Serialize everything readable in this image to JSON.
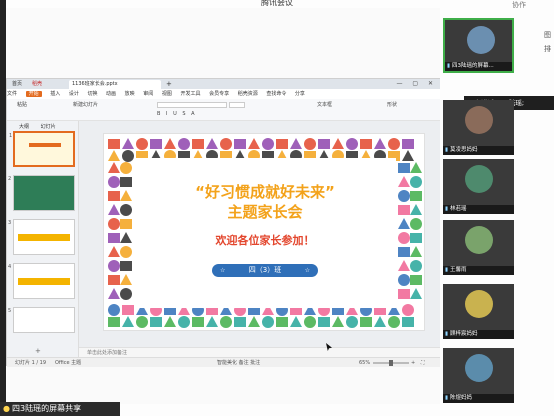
{
  "meeting": {
    "title": "腾讯会议",
    "window_right": "协作"
  },
  "wps": {
    "tabs": [
      "首页",
      "稻壳",
      "1136班家长会.pptx",
      "+"
    ],
    "menu": [
      "文件",
      "开始",
      "插入",
      "设计",
      "切换",
      "动画",
      "放映",
      "审阅",
      "视图",
      "开发工具",
      "会员专享",
      "稻壳资源",
      "查找命令",
      "分享"
    ],
    "ribbon": {
      "paste": "粘贴",
      "new_slide": "新建幻灯片",
      "textbox": "文本框",
      "shape": "形状"
    },
    "sidebar_tabs": [
      "大纲",
      "幻灯片"
    ],
    "thumb_numbers": [
      "1",
      "2",
      "3",
      "4",
      "5"
    ],
    "add_slide": "+",
    "note": "单击此处添加备注",
    "status": {
      "slide": "幻灯片 1 / 19",
      "theme": "Office 主题",
      "mid": "智能美化   备注   批注",
      "zoom": "65%",
      "plus": "+",
      "fit": "⛶"
    }
  },
  "slide": {
    "title_line1": "“好习惯成就好未来”",
    "title_line2": "主题家长会",
    "subtitle": "欢迎各位家长参加！",
    "class_label": "四（3）班",
    "star": "☆"
  },
  "share_label": "四3陆瑶的屏幕共享",
  "speaking": "正在讲话: 四3陆瑶;",
  "participants": [
    {
      "name": "四3陆瑶的屏幕...",
      "color": "#6b8fb0",
      "active": true
    },
    {
      "name": "莫凌思妈妈",
      "color": "#8a6b5a",
      "active": false
    },
    {
      "name": "林若瑶",
      "color": "#4e8a6d",
      "active": false
    },
    {
      "name": "王馨雨",
      "color": "#7aa36b",
      "active": false
    },
    {
      "name": "顾梓宸妈妈",
      "color": "#c9b24f",
      "active": false
    },
    {
      "name": "陈煜妈妈",
      "color": "#5b8cab",
      "active": false
    }
  ],
  "side_buttons": [
    "图",
    "排"
  ]
}
